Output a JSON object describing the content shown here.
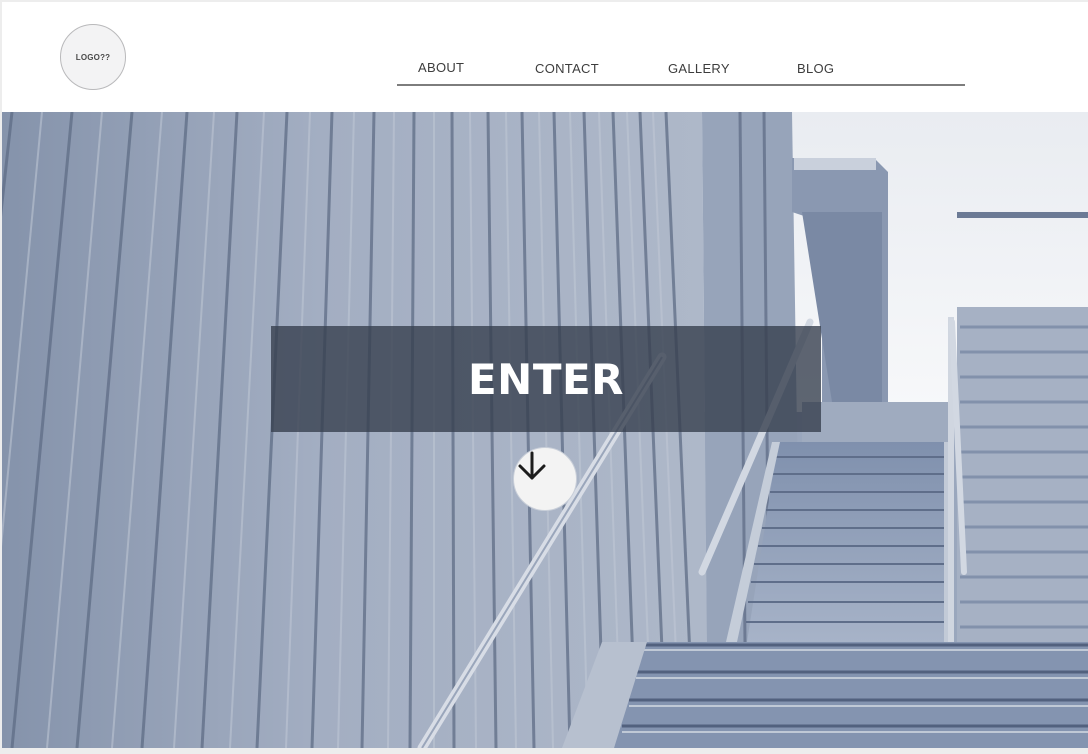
{
  "header": {
    "logo_text": "LOGO??",
    "nav": [
      {
        "label": "ABOUT"
      },
      {
        "label": "CONTACT"
      },
      {
        "label": "GALLERY"
      },
      {
        "label": "BLOG"
      }
    ]
  },
  "hero": {
    "background_image": "wooden-wall-staircase-photo",
    "cta_label": "ENTER",
    "scroll_icon": "arrow-down-icon",
    "tint_color": "#9aa7bd",
    "banner_color": "#37404f"
  }
}
